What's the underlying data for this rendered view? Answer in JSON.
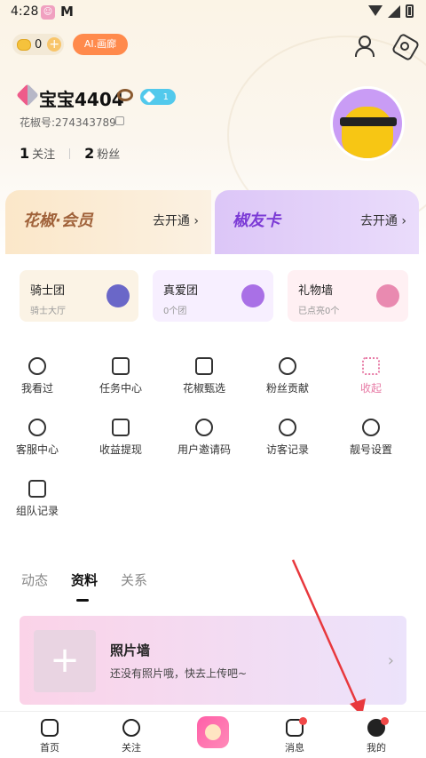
{
  "status_bar": {
    "time": "4:28",
    "app_glyph": "M"
  },
  "header": {
    "coins": "0",
    "ai_button": "AI.画廊"
  },
  "profile": {
    "nickname": "宝宝4404",
    "level_badge": "1",
    "id_text": "花椒号:274343789",
    "following_count": "1",
    "following_label": "关注",
    "fans_count": "2",
    "fans_label": "粉丝"
  },
  "vip": {
    "member_title": "花椒·会员",
    "member_action": "去开通 ›",
    "friend_title": "椒友卡",
    "friend_action": "去开通 ›"
  },
  "cards": [
    {
      "title": "骑士团",
      "sub": "骑士大厅"
    },
    {
      "title": "真爱团",
      "sub": "0个团"
    },
    {
      "title": "礼物墙",
      "sub": "已点亮0个"
    }
  ],
  "grid": [
    "我看过",
    "任务中心",
    "花椒甄选",
    "粉丝贡献",
    "收起",
    "客服中心",
    "收益提现",
    "用户邀请码",
    "访客记录",
    "靓号设置",
    "组队记录"
  ],
  "tabs": [
    "动态",
    "资料",
    "关系"
  ],
  "photo_wall": {
    "title": "照片墙",
    "subtitle": "还没有照片哦，快去上传吧~"
  },
  "tabbar": {
    "home": "首页",
    "follow": "关注",
    "messages": "消息",
    "mine": "我的"
  },
  "colors": {
    "accent_pink": "#e77aa5",
    "vip_gold": "#a0623a",
    "vip_purple": "#7c3bd6",
    "arrow_red": "#e8383d"
  }
}
